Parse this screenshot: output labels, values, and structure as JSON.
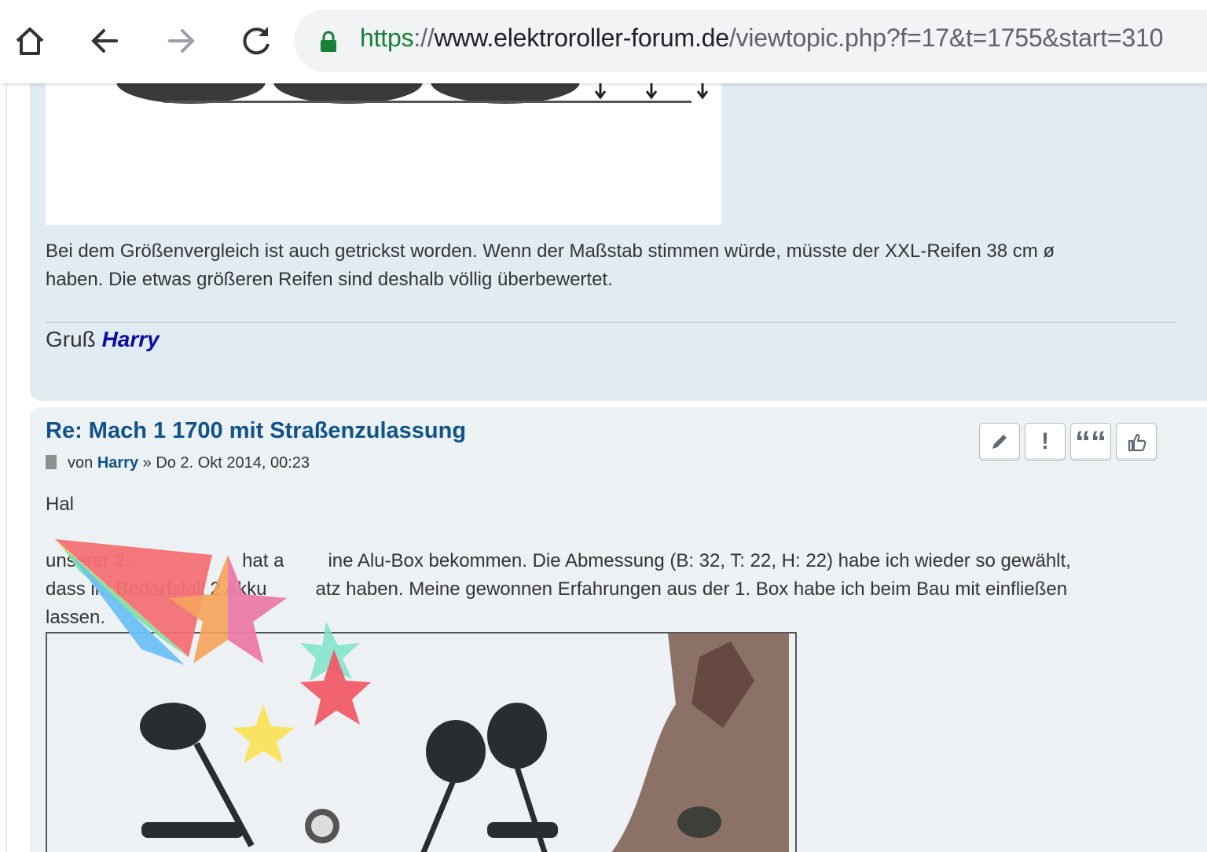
{
  "browser": {
    "url_scheme": "https",
    "url_sep": "://",
    "url_host": "www.elektroroller-forum.de",
    "url_path": "/viewtopic.php?f=17&t=1755&start=310",
    "icons": [
      "home-icon",
      "back-icon",
      "forward-icon",
      "reload-icon",
      "lock-icon"
    ]
  },
  "post1": {
    "body_line1": "Bei dem Größenvergleich ist auch getrickst worden. Wenn der Maßstab stimmen würde, müsste der XXL-Reifen 38 cm ø",
    "body_line2": "haben. Die etwas größeren Reifen sind deshalb völlig überbewertet.",
    "signature_greeting": "Gruß",
    "signature_name": "Harry"
  },
  "post2": {
    "title": "Re: Mach 1 1700 mit Straßenzulassung",
    "meta_prefix": "von",
    "author": "Harry",
    "meta_sep": "»",
    "date": "Do 2. Okt 2014, 00:23",
    "greeting": "Hal",
    "body_line1a": "unserer 2.",
    "body_line1b": "hat a",
    "body_line1c": "ine Alu-Box bekommen. Die Abmessung (B: 32, T: 22, H: 22) habe ich wieder so gewählt,",
    "body_line2a": "dass im Bedarfsfall 2 Akku",
    "body_line2b": "atz haben. Meine gewonnen Erfahrungen aus der 1. Box habe ich beim Bau mit einfließen",
    "body_line3": "lassen.",
    "action_icons": [
      "edit-icon",
      "report-icon",
      "quote-icon",
      "like-icon"
    ],
    "report_glyph": "!",
    "quote_glyph": "““"
  },
  "colors": {
    "post_bg_1": "#e1ebf2",
    "post_bg_2": "#ecf1f3",
    "title_blue": "#105289",
    "signature_blue": "#0a0aa8",
    "url_green": "#188038"
  }
}
